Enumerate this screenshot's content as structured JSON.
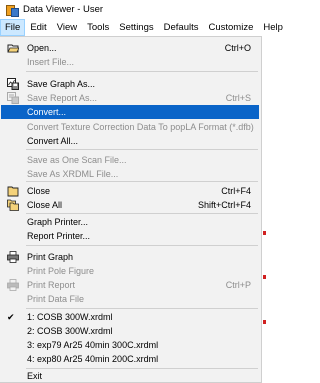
{
  "window": {
    "title": "Data Viewer - User"
  },
  "menubar": [
    "File",
    "Edit",
    "View",
    "Tools",
    "Settings",
    "Defaults",
    "Customize",
    "Help"
  ],
  "file_menu": {
    "open": {
      "label": "Open...",
      "shortcut": "Ctrl+O",
      "icon": "open-folder-icon"
    },
    "insert_file": {
      "label": "Insert File..."
    },
    "save_graph_as": {
      "label": "Save Graph As...",
      "icon": "save-graph-icon"
    },
    "save_report_as": {
      "label": "Save Report As...",
      "shortcut": "Ctrl+S",
      "icon": "save-report-icon"
    },
    "convert": {
      "label": "Convert..."
    },
    "convert_texture": {
      "label": "Convert Texture Correction Data To popLA Format (*.dfb)"
    },
    "convert_all": {
      "label": "Convert All..."
    },
    "save_as_one_scan": {
      "label": "Save as One Scan File..."
    },
    "save_as_xrdml": {
      "label": "Save As XRDML File..."
    },
    "close": {
      "label": "Close",
      "shortcut": "Ctrl+F4",
      "icon": "close-folder-icon"
    },
    "close_all": {
      "label": "Close All",
      "shortcut": "Shift+Ctrl+F4",
      "icon": "close-all-icon"
    },
    "graph_printer": {
      "label": "Graph Printer..."
    },
    "report_printer": {
      "label": "Report Printer..."
    },
    "print_graph": {
      "label": "Print Graph",
      "icon": "printer-icon"
    },
    "print_pole_figure": {
      "label": "Print Pole Figure"
    },
    "print_report": {
      "label": "Print Report",
      "shortcut": "Ctrl+P",
      "icon": "printer-icon"
    },
    "print_data_file": {
      "label": "Print Data File"
    },
    "recent": [
      "1: COSB 300W.xrdml",
      "2: COSB 300W.xrdml",
      "3: exp79 Ar25 40min 300C.xrdml",
      "4: exp80 Ar25 40min 200C.xrdml"
    ],
    "exit": {
      "label": "Exit"
    }
  },
  "colors": {
    "highlight": "#0a64c8",
    "menu_bg": "#f2f2f2",
    "disabled_text": "#8d8d8d"
  }
}
